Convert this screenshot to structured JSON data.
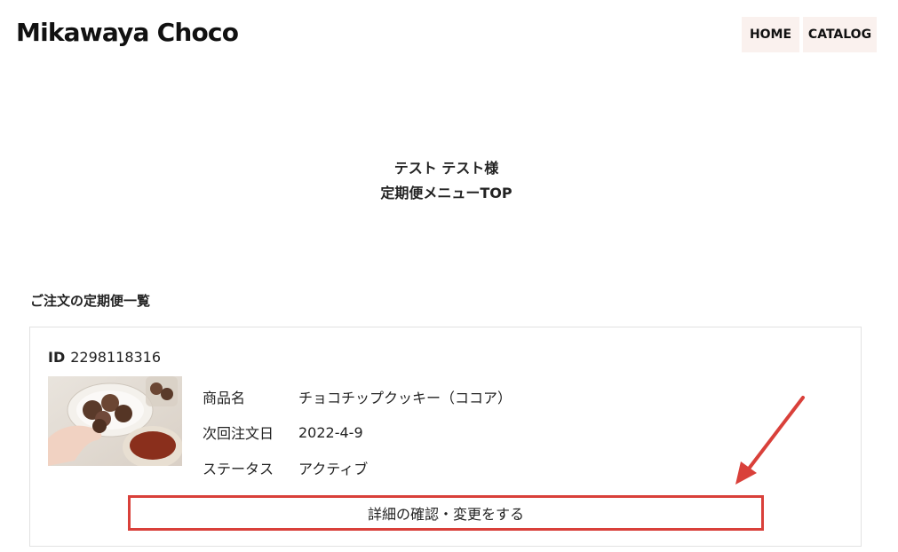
{
  "header": {
    "logo": "Mikawaya Choco",
    "nav": [
      "HOME",
      "CATALOG"
    ]
  },
  "title": {
    "line1": "テスト テスト様",
    "line2": "定期便メニューTOP"
  },
  "section": {
    "heading": "ご注文の定期便一覧"
  },
  "order": {
    "id_label": "ID",
    "id_value": "2298118316",
    "image_icon": "product-photo",
    "fields": [
      {
        "label": "商品名",
        "value": "チョコチップクッキー（ココア）"
      },
      {
        "label": "次回注文日",
        "value": "2022-4-9"
      },
      {
        "label": "ステータス",
        "value": "アクティブ"
      }
    ],
    "button_label": "詳細の確認・変更をする"
  },
  "annotation": {
    "highlight_color": "#d9403a",
    "arrow_icon": "red-arrow"
  }
}
